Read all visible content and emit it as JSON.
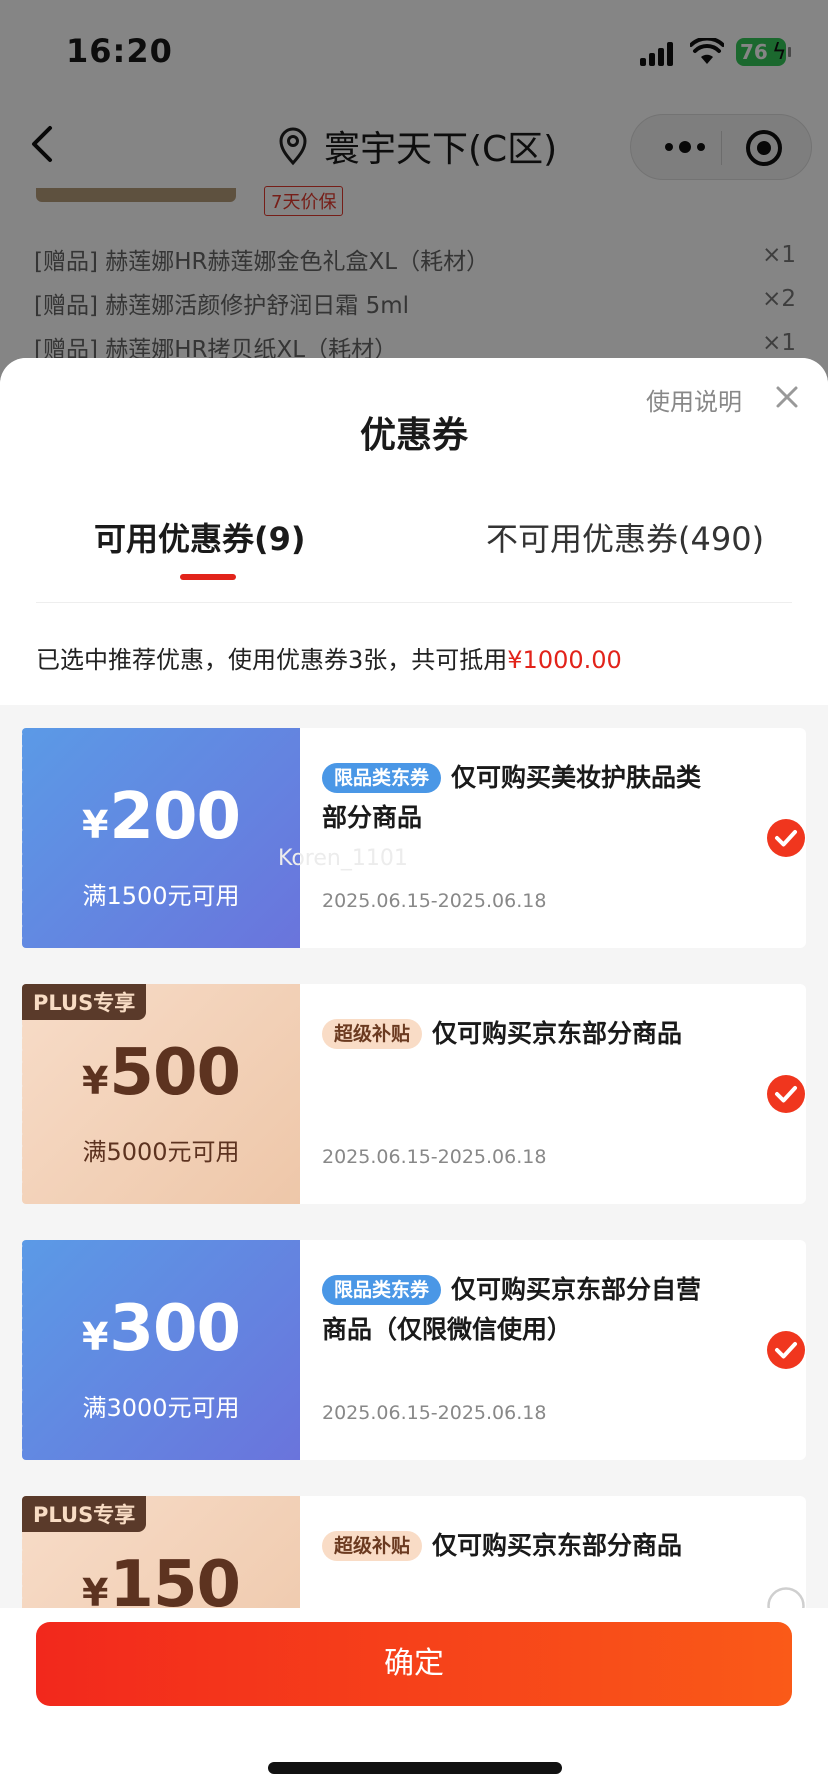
{
  "status_bar": {
    "time": "16:20",
    "battery": "76"
  },
  "nav": {
    "title": "寰宇天下(C区)"
  },
  "order": {
    "price_tag": "7天价保",
    "gifts": [
      {
        "name": "[赠品] 赫莲娜HR赫莲娜金色礼盒XL（耗材）",
        "qty": "×1"
      },
      {
        "name": "[赠品] 赫莲娜活颜修护舒润日霜 5ml",
        "qty": "×2"
      },
      {
        "name": "[赠品] 赫莲娜HR拷贝纸XL（耗材）",
        "qty": "×1"
      }
    ]
  },
  "sheet": {
    "title": "优惠券",
    "help_link": "使用说明",
    "tabs": {
      "available": "可用优惠券(9)",
      "unavailable": "不可用优惠券(490)"
    },
    "summary_prefix": "已选中推荐优惠，使用优惠券3张，共可抵用",
    "summary_amount": "¥1000.00"
  },
  "coupons": [
    {
      "style": "blue",
      "plus": "",
      "currency": "¥",
      "amount": "200",
      "condition": "满1500元可用",
      "tag": "限品类东券",
      "desc": "仅可购买美妆护肤品类部分商品",
      "date": "2025.06.15-2025.06.18",
      "selected": true,
      "watermark": "Koren_1101"
    },
    {
      "style": "peach",
      "plus": "PLUS专享",
      "currency": "¥",
      "amount": "500",
      "condition": "满5000元可用",
      "tag": "超级补贴",
      "desc": "仅可购买京东部分商品",
      "date": "2025.06.15-2025.06.18",
      "selected": true
    },
    {
      "style": "blue",
      "plus": "",
      "currency": "¥",
      "amount": "300",
      "condition": "满3000元可用",
      "tag": "限品类东券",
      "desc": "仅可购买京东部分自营商品（仅限微信使用）",
      "date": "2025.06.15-2025.06.18",
      "selected": true
    },
    {
      "style": "peach",
      "plus": "PLUS专享",
      "currency": "¥",
      "amount": "150",
      "condition": "",
      "tag": "超级补贴",
      "desc": "仅可购买京东部分商品",
      "date": "",
      "selected": false
    }
  ],
  "footer": {
    "confirm_label": "确定"
  }
}
